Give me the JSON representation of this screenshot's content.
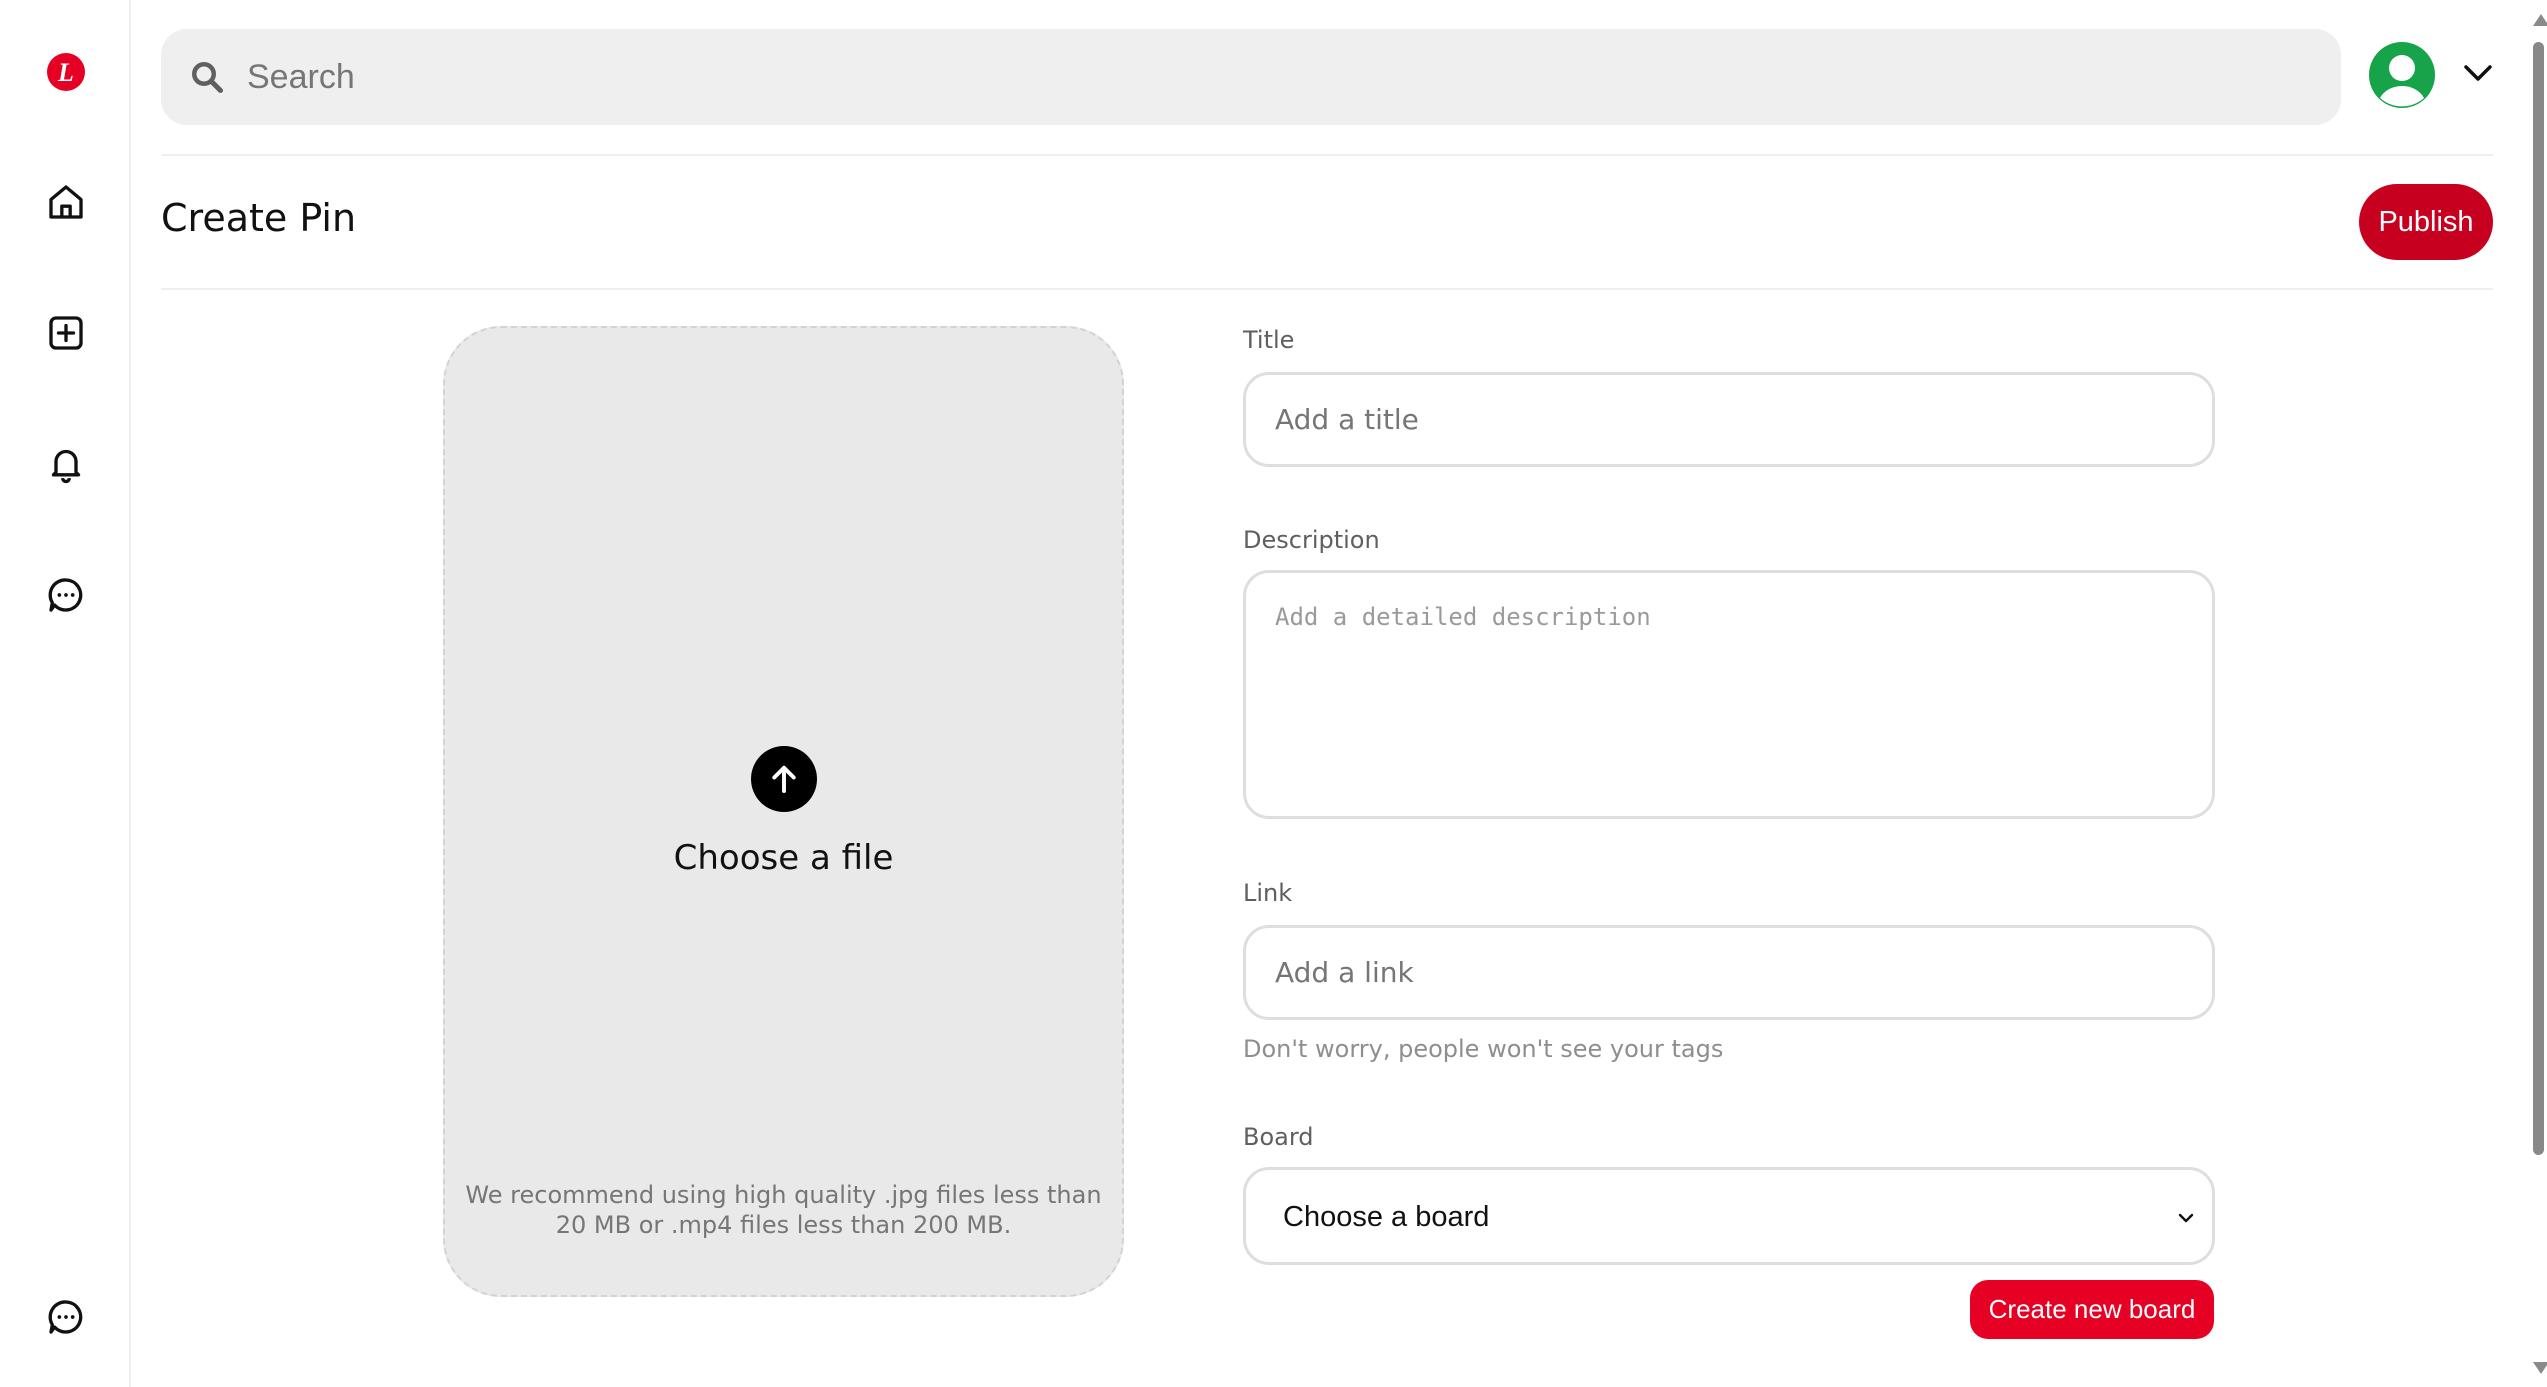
{
  "app": {
    "logo_letter": "L",
    "logo_icon": "brand-logo",
    "accent_color": "#e60023",
    "publish_color": "#c8001f"
  },
  "sidebar": {
    "items": [
      {
        "icon": "home-icon",
        "label": "Home"
      },
      {
        "icon": "plus-square-icon",
        "label": "Create"
      },
      {
        "icon": "bell-icon",
        "label": "Notifications"
      },
      {
        "icon": "chat-icon",
        "label": "Messages"
      }
    ],
    "bottom_icon": "chat-icon"
  },
  "search": {
    "placeholder": "Search",
    "value": ""
  },
  "header": {
    "title": "Create Pin",
    "publish_label": "Publish",
    "avatar_icon": "user-avatar-icon",
    "menu_icon": "chevron-down-icon"
  },
  "upload": {
    "icon": "arrow-up-icon",
    "label": "Choose a file",
    "recommendation": "We recommend using high quality .jpg files less than 20 MB or .mp4 files less than 200 MB."
  },
  "form": {
    "title_label": "Title",
    "title_placeholder": "Add a title",
    "description_label": "Description",
    "description_placeholder": "Add a detailed description",
    "link_label": "Link",
    "link_placeholder": "Add a link",
    "link_hint": "Don't worry, people won't see your tags",
    "board_label": "Board",
    "board_selected": "Choose a board",
    "create_board_label": "Create new board"
  }
}
